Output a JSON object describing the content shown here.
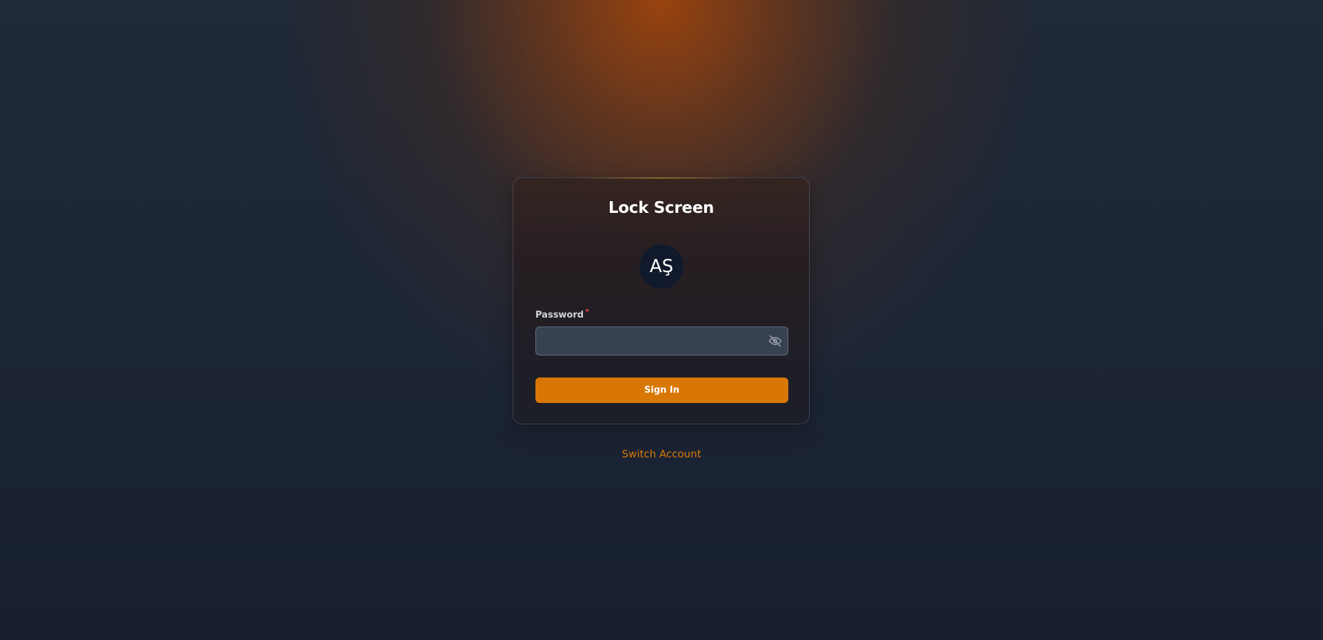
{
  "lock": {
    "title": "Lock Screen",
    "avatar_initials": "AŞ",
    "password_label": "Password",
    "required_mark": "*",
    "password_value": "",
    "sign_in_label": "Sign In",
    "switch_account_label": "Switch Account",
    "visibility_icon": "eye-off-icon"
  },
  "colors": {
    "accent": "#d97706",
    "required": "#ef4444",
    "avatar_bg": "#101a2c",
    "input_bg": "#374151"
  }
}
